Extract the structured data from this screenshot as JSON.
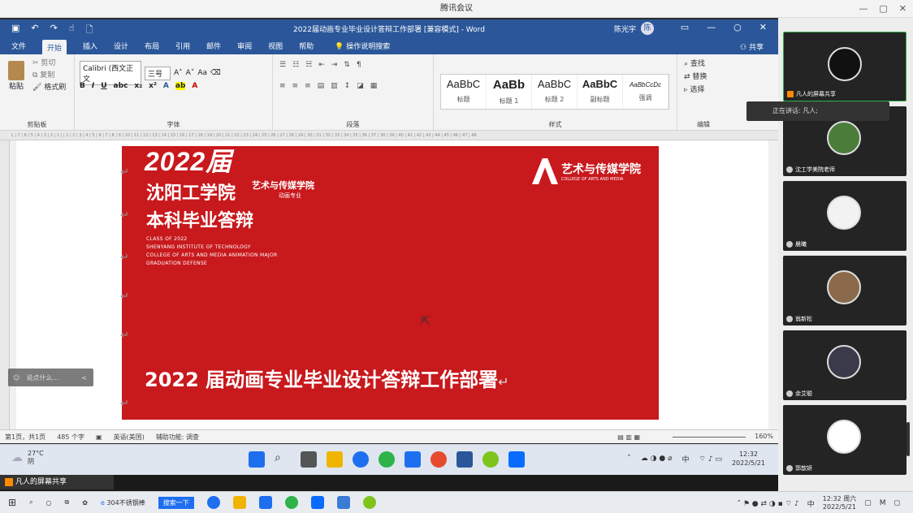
{
  "tencent": {
    "title": "腾讯会议",
    "controls": [
      "—",
      "▢",
      "✕"
    ]
  },
  "word": {
    "doc_title": "2022届动画专业毕业设计答辩工作部署 [兼容模式] - Word",
    "user": "陈光宇",
    "user_initial": "陈",
    "tabs": [
      "文件",
      "开始",
      "插入",
      "设计",
      "布局",
      "引用",
      "邮件",
      "审阅",
      "视图",
      "帮助"
    ],
    "tellme": "操作说明搜索",
    "share": "共享",
    "ribbon": {
      "clipboard": {
        "paste": "粘贴",
        "cut": "剪切",
        "copy": "复制",
        "format_painter": "格式刷",
        "label": "剪贴板"
      },
      "font": {
        "name": "Calibri (西文正文",
        "size": "三号",
        "label": "字体"
      },
      "paragraph": {
        "label": "段落"
      },
      "styles": {
        "items": [
          {
            "preview": "AaBbC",
            "name": "标题"
          },
          {
            "preview": "AaBb",
            "name": "标题 1"
          },
          {
            "preview": "AaBbC",
            "name": "标题 2"
          },
          {
            "preview": "AaBbC",
            "name": "副标题"
          },
          {
            "preview": "AaBbCcDc",
            "name": "强调"
          }
        ],
        "label": "样式"
      },
      "editing": {
        "find": "查找",
        "replace": "替换",
        "select": "选择",
        "label": "编辑"
      }
    },
    "ruler": "L | 7 | 6 | 5 | 4 | 3 | 2 | 1 | | 1 | 2 | 3 | 4 | 5 | 6 | 7 | 8 | 9 | 10 | 11 | 12 | 13 | 14 | 15 | 16 | 17 | 18 | 19 | 20 | 21 | 22 | 23 | 24 | 25 | 26 | 27 | 28 | 29 | 30 | 31 | 32 | 33 | 34 | 35 | 36 | 37 | 38 | 39 | 40 | 41 | 42 | 43 | 44 | 45 | 46 | 47 | 48",
    "status": {
      "page": "第1页，共1页",
      "words": "485 个字",
      "lang": "英语(美国)",
      "access": "辅助功能: 调查",
      "zoom": "160%"
    }
  },
  "slide": {
    "year": "2022届",
    "school": "沈阳工学院",
    "college": "艺术与传媒学院",
    "major_tag": "动画专业",
    "defense": "本科毕业答辩",
    "english": [
      "CLASS OF 2022",
      "SHENYANG INSTITUTE OF TECHNOLOGY",
      "COLLEGE OF ARTS AND MEDIA    ANIMATION MAJOR",
      "GRADUATION DEFENSE"
    ],
    "logo_cn": "艺术与传媒学院",
    "logo_en": "COLLEGE OF ARTS AND MEDIA",
    "main": "2022 届动画专业毕业设计答辩工作部署",
    "para_mark": "↵"
  },
  "chat": {
    "placeholder": "说点什么…",
    "arrow": "<"
  },
  "taskbar1": {
    "temp": "27°C",
    "weather": "阴",
    "time": "12:32",
    "date": "2022/5/21",
    "ime": "中"
  },
  "sharebar": {
    "label": "凡人的屏幕共享"
  },
  "participants": [
    {
      "name": "凡人的屏幕共享",
      "initial": "●"
    },
    {
      "name": "沈工学美院老师",
      "initial": "●"
    },
    {
      "name": "晨曦",
      "initial": "●"
    },
    {
      "name": "翁新松",
      "initial": "●"
    },
    {
      "name": "余艾聪",
      "initial": "●"
    },
    {
      "name": "郭歆妍",
      "initial": "●"
    }
  ],
  "speaking": "正在讲话: 凡人;",
  "taskbar2": {
    "search": "搜索一下",
    "app_label": "304不锈钢棒",
    "time": "12:32 周六",
    "date": "2022/5/21",
    "ime": "中"
  }
}
